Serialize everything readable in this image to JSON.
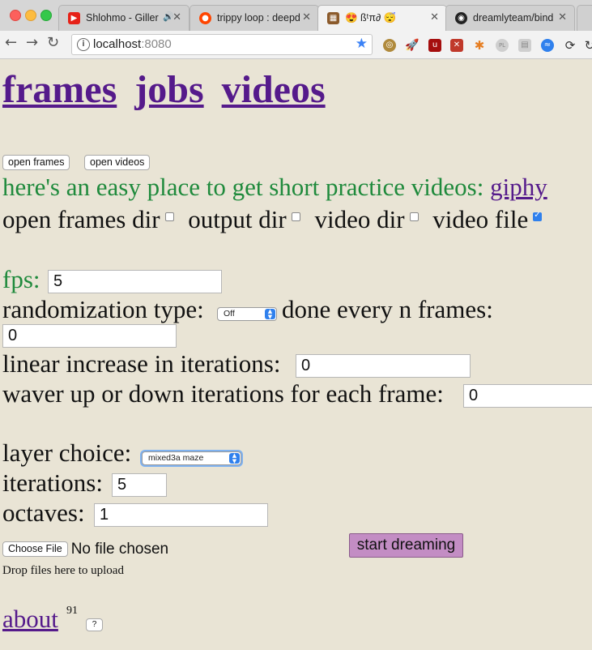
{
  "browser": {
    "tabs": [
      {
        "title": "Shlohmo - Giller",
        "favicon": "youtube-icon",
        "color": "#e62117",
        "active": false
      },
      {
        "title": "trippy loop : deepd",
        "favicon": "reddit-icon",
        "color": "#ff4500",
        "active": false
      },
      {
        "title": "😍 ßᵗπ∂ 😴",
        "favicon": "image-icon",
        "color": "#8b5a2b",
        "active": true
      },
      {
        "title": "dreamlyteam/bind",
        "favicon": "github-icon",
        "color": "#222222",
        "active": false
      }
    ],
    "url_host": "localhost",
    "url_port": ":8080",
    "extensions": [
      "chrome-ext-icon",
      "rocket-icon",
      "ublock-icon",
      "ext-red-icon",
      "pinwheel-icon",
      "pl-icon",
      "doc-icon",
      "sync-icon",
      "refresh-icon",
      "reload-icon"
    ]
  },
  "nav": {
    "frames": "frames",
    "jobs": "jobs",
    "videos": "videos"
  },
  "buttons": {
    "open_frames": "open frames",
    "open_videos": "open videos"
  },
  "practice": {
    "text": "here's an easy place to get short practice videos: ",
    "link": "giphy"
  },
  "options": {
    "open_frames_dir": {
      "label": "open frames dir",
      "checked": false
    },
    "output_dir": {
      "label": "output dir",
      "checked": false
    },
    "video_dir": {
      "label": "video dir",
      "checked": false
    },
    "video_file": {
      "label": "video file",
      "checked": true
    }
  },
  "form": {
    "fps_label": "fps:",
    "fps_value": "5",
    "randomization_label": "randomization type:",
    "randomization_value": "Off",
    "every_n_label": "done every n frames:",
    "every_n_value": "0",
    "linear_label": "linear increase in iterations:",
    "linear_value": "0",
    "waver_label": "waver up or down iterations for each frame:",
    "waver_value": "0",
    "layer_label": "layer choice:",
    "layer_value": "mixed3a maze",
    "iterations_label": "iterations:",
    "iterations_value": "5",
    "octaves_label": "octaves:",
    "octaves_value": "1"
  },
  "file": {
    "choose_label": "Choose File",
    "status": "No file chosen",
    "drop_hint": "Drop files here to upload"
  },
  "start_button": "start dreaming",
  "footer": {
    "about": "about",
    "count": "91",
    "help": "?"
  }
}
